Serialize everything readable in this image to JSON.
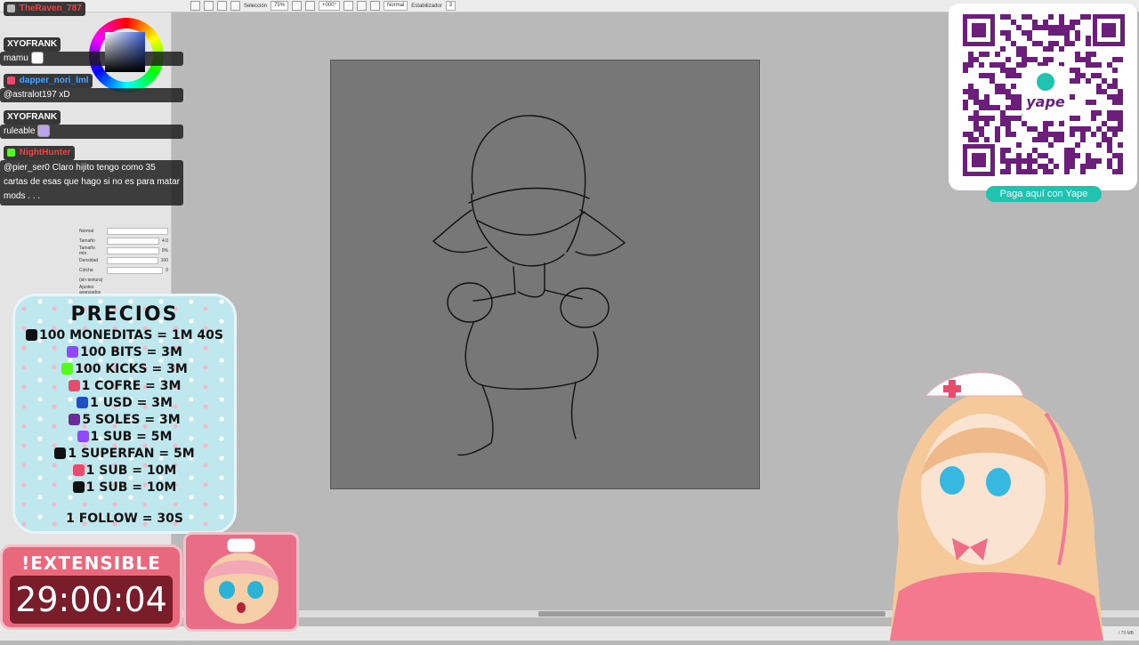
{
  "toolbar": {
    "selection_label": "Selección",
    "zoom": "75%",
    "rotation": "+000°",
    "blend_mode": "Normal",
    "stabilizer_label": "Estabilizador",
    "stabilizer_value": "3"
  },
  "brush_panel": {
    "mode": "Normal",
    "size_label": "Tamaño",
    "size_value": "4.0",
    "min_size_label": "Tamaño mín.",
    "min_size_value": "0%",
    "density_label": "Densidad",
    "density_value": "100",
    "blending_label": "Colcha",
    "blending_value": "0",
    "texture_label": "(sin textura)",
    "advanced_label": "Ajustes avanzados"
  },
  "chat": [
    {
      "user": "TheRaven_787",
      "color": "#ff3b3b",
      "text": ""
    },
    {
      "user": "XYOFRANK",
      "color": "#ffffff",
      "text": "mamu"
    },
    {
      "user": "dapper_nori_lml",
      "color": "#4aa3ff",
      "text": "@astralot197 xD"
    },
    {
      "user": "XYOFRANK",
      "color": "#ffffff",
      "text": "ruleable"
    },
    {
      "user": "NightHunter",
      "color": "#ff3b3b",
      "text": "@pier_ser0 Claro  hijito tengo como 35 cartas de esas que hago si no es para matar mods . . ."
    }
  ],
  "prices": {
    "title": "PRECIOS",
    "rows": [
      {
        "text": "100 MONEDITAS = 1M 40S",
        "icon": "tiktok-icon",
        "color": "#111111"
      },
      {
        "text": "100 BITS = 3M",
        "icon": "twitch-icon",
        "color": "#9146ff"
      },
      {
        "text": "100 KICKS = 3M",
        "icon": "kick-icon",
        "color": "#53fc18"
      },
      {
        "text": "1 COFRE = 3M",
        "icon": "chest-icon",
        "color": "#e84b6b"
      },
      {
        "text": "1 USD = 3M",
        "icon": "paypal-icon",
        "color": "#1e4fbf"
      },
      {
        "text": "5 SOLES = 3M",
        "icon": "yape-icon",
        "color": "#6c2a9c"
      },
      {
        "text": "1 SUB = 5M",
        "icon": "twitch-icon",
        "color": "#9146ff"
      },
      {
        "text": "1 SUPERFAN = 5M",
        "icon": "tiktok-icon",
        "color": "#111111"
      },
      {
        "text": "1 SUB = 10M",
        "icon": "chest-icon",
        "color": "#e84b6b"
      },
      {
        "text": "1 SUB = 10M",
        "icon": "kick-icon",
        "color": "#111111"
      }
    ],
    "follow": "1 FOLLOW = 30S"
  },
  "timer": {
    "label": "!EXTENSIBLE",
    "value": "29:00:04"
  },
  "qr": {
    "button": "Paga aquí con Yape",
    "brand": "yape"
  },
  "status": {
    "memory": "/ 79 MB"
  }
}
